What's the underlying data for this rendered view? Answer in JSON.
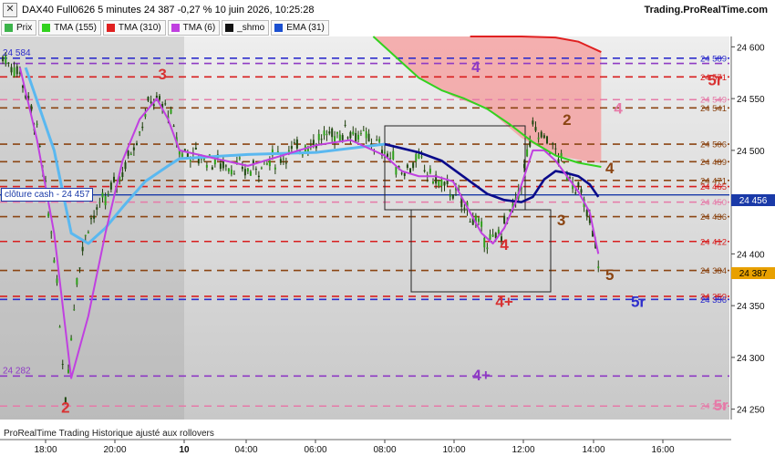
{
  "header": {
    "title": "DAX40 Full0626 5 minutes 24 387 -0,27 % 10 juin 2026, 10:25:28",
    "brand": "Trading.ProRealTime.com",
    "close_symbol": "✕"
  },
  "legend": [
    {
      "label": "Prix",
      "color": "#3cb44b"
    },
    {
      "label": "TMA (155)",
      "color": "#32d21e"
    },
    {
      "label": "TMA (310)",
      "color": "#e02020"
    },
    {
      "label": "TMA (6)",
      "color": "#c040e0"
    },
    {
      "label": "_shmo",
      "color": "#111111"
    },
    {
      "label": "EMA (31)",
      "color": "#1a4fd0"
    }
  ],
  "close_cash_label": "clôture cash -  24 457",
  "footer": "ProRealTime Trading  Historique ajusté aux rollovers",
  "axis_badges": {
    "price": "24 387",
    "cash": "24 456"
  },
  "chart_data": {
    "type": "line",
    "ylim": [
      24240,
      24610
    ],
    "y_ticks": [
      "24 600",
      "24 550",
      "24 500",
      "24 450",
      "24 400",
      "24 350",
      "24 300",
      "24 250"
    ],
    "x_ticks": [
      "18:00",
      "20:00",
      "10",
      "04:00",
      "06:00",
      "08:00",
      "10:00",
      "12:00",
      "14:00",
      "16:00"
    ],
    "levels": [
      {
        "value": 24589,
        "color": "#2e2ecc",
        "label": "24 589",
        "left_label": "24 584"
      },
      {
        "value": 24584,
        "color": "#8e3ac4"
      },
      {
        "value": 24571,
        "color": "#d81e1e",
        "label": "24 571"
      },
      {
        "value": 24549,
        "color": "#e67aa8",
        "label": "24 549"
      },
      {
        "value": 24541,
        "color": "#8b4513",
        "label": "24 541"
      },
      {
        "value": 24506,
        "color": "#8b4513",
        "label": "24 506"
      },
      {
        "value": 24489,
        "color": "#8b4513",
        "label": "24 489"
      },
      {
        "value": 24471,
        "color": "#8b4513",
        "label": "24 471"
      },
      {
        "value": 24465,
        "color": "#d81e1e",
        "label": "24 465"
      },
      {
        "value": 24450,
        "color": "#e67aa8",
        "label": "24 450"
      },
      {
        "value": 24436,
        "color": "#8b4513",
        "label": "24 436"
      },
      {
        "value": 24412,
        "color": "#d81e1e",
        "label": "24 412"
      },
      {
        "value": 24384,
        "color": "#8b4513",
        "label": "24 384"
      },
      {
        "value": 24359,
        "color": "#d81e1e",
        "label": "24 359"
      },
      {
        "value": 24356,
        "color": "#2e2ecc",
        "label": "24 356"
      },
      {
        "value": 24282,
        "color": "#8e3ac4",
        "left_label": "24 282"
      },
      {
        "value": 24253,
        "color": "#e67aa8",
        "label": "24 253"
      }
    ],
    "annotations": [
      {
        "text": "2",
        "x": "18:40",
        "y": 24252,
        "color": "#d83232"
      },
      {
        "text": "3",
        "x": "21:30",
        "y": 24574,
        "color": "#d83232"
      },
      {
        "text": "4",
        "x": "06:40",
        "y": 24581,
        "color": "#8e3ac4"
      },
      {
        "text": "5r",
        "x": "13:40",
        "y": 24568,
        "color": "#d83232"
      },
      {
        "text": "4",
        "x": "10:50",
        "y": 24541,
        "color": "#e67aa8"
      },
      {
        "text": "2",
        "x": "09:20",
        "y": 24530,
        "color": "#8b4513"
      },
      {
        "text": "4",
        "x": "10:35",
        "y": 24483,
        "color": "#8b4513"
      },
      {
        "text": "3",
        "x": "09:10",
        "y": 24433,
        "color": "#8b4513"
      },
      {
        "text": "4",
        "x": "07:30",
        "y": 24409,
        "color": "#d83232"
      },
      {
        "text": "5",
        "x": "10:35",
        "y": 24380,
        "color": "#8b4513"
      },
      {
        "text": "4+",
        "x": "07:30",
        "y": 24354,
        "color": "#d83232"
      },
      {
        "text": "5r",
        "x": "11:25",
        "y": 24354,
        "color": "#2e2ecc"
      },
      {
        "text": "4+",
        "x": "06:50",
        "y": 24283,
        "color": "#8e3ac4"
      },
      {
        "text": "5r",
        "x": "13:50",
        "y": 24254,
        "color": "#e67aa8"
      }
    ],
    "close_cash": 24457,
    "last_price": 24387,
    "series": [
      {
        "name": "Prix",
        "color": "#2a7a10",
        "x": [
          "16:50",
          "17:20",
          "17:50",
          "18:20",
          "18:40",
          "19:00",
          "19:20",
          "19:50",
          "20:20",
          "20:50",
          "21:10",
          "21:40",
          "22:00",
          "00:00",
          "02:00",
          "03:00",
          "04:00",
          "04:30",
          "05:00",
          "05:30",
          "06:00",
          "06:30",
          "06:50",
          "07:10",
          "07:30",
          "07:50",
          "08:00",
          "08:20",
          "08:40",
          "09:00",
          "09:20",
          "09:40",
          "10:00",
          "10:20"
        ],
        "values": [
          24590,
          24575,
          24520,
          24400,
          24262,
          24380,
          24430,
          24452,
          24480,
          24520,
          24550,
          24540,
          24500,
          24480,
          24510,
          24520,
          24500,
          24480,
          24490,
          24470,
          24460,
          24440,
          24420,
          24410,
          24428,
          24448,
          24470,
          24520,
          24512,
          24498,
          24480,
          24462,
          24430,
          24382
        ]
      },
      {
        "name": "EMA (31)",
        "color": "#5ab8f0",
        "x": [
          "17:30",
          "18:20",
          "18:50",
          "19:20",
          "19:50",
          "20:20",
          "21:00",
          "21:40",
          "22:00",
          "00:00",
          "02:00",
          "03:00",
          "04:00"
        ],
        "values": [
          24580,
          24500,
          24420,
          24410,
          24425,
          24445,
          24470,
          24485,
          24492,
          24496,
          24498,
          24502,
          24506
        ]
      },
      {
        "name": "_shmo",
        "color": "#0a0a8a",
        "x": [
          "04:00",
          "05:00",
          "05:40",
          "06:00",
          "06:30",
          "07:00",
          "07:30",
          "08:00",
          "08:20",
          "08:40",
          "09:00",
          "09:20",
          "09:40",
          "10:00",
          "10:15"
        ],
        "values": [
          24506,
          24498,
          24490,
          24482,
          24470,
          24458,
          24452,
          24450,
          24455,
          24472,
          24480,
          24478,
          24475,
          24467,
          24455
        ]
      },
      {
        "name": "TMA (6)",
        "color": "#c040e0",
        "x": [
          "17:20",
          "17:50",
          "18:20",
          "18:50",
          "19:20",
          "19:50",
          "20:20",
          "20:50",
          "21:20",
          "21:40",
          "22:00",
          "00:00",
          "02:00",
          "03:00",
          "04:00",
          "04:30",
          "05:00",
          "05:30",
          "06:00",
          "06:30",
          "06:50",
          "07:10",
          "07:30",
          "07:50",
          "08:20",
          "08:40",
          "09:00",
          "09:20",
          "09:40",
          "10:00",
          "10:15"
        ],
        "values": [
          24580,
          24510,
          24420,
          24280,
          24340,
          24420,
          24490,
          24530,
          24550,
          24530,
          24500,
          24485,
          24505,
          24510,
          24495,
          24480,
          24475,
          24475,
          24470,
          24440,
          24420,
          24410,
          24425,
          24450,
          24500,
          24500,
          24490,
          24475,
          24460,
          24440,
          24400
        ]
      },
      {
        "name": "TMA (155)",
        "color": "#32d21e",
        "x": [
          "03:40",
          "04:20",
          "05:00",
          "05:40",
          "06:20",
          "07:00",
          "07:40",
          "08:20",
          "09:00",
          "09:40",
          "10:20"
        ],
        "values": [
          24610,
          24590,
          24570,
          24558,
          24550,
          24540,
          24525,
          24508,
          24495,
          24488,
          24484
        ]
      },
      {
        "name": "TMA (310)",
        "color": "#e02020",
        "x": [
          "06:30",
          "07:00",
          "08:00",
          "09:00",
          "09:40",
          "10:00",
          "10:20"
        ],
        "values": [
          24610,
          24610,
          24610,
          24609,
          24605,
          24600,
          24595
        ]
      }
    ]
  }
}
